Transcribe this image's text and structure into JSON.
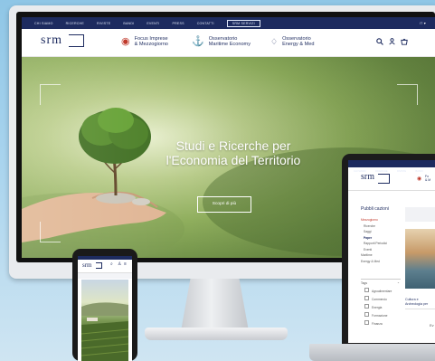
{
  "desktop": {
    "topbar": {
      "items": [
        "CHI SIAMO",
        "RICERCHE",
        "RIVISTE",
        "BANDI",
        "EVENTI",
        "PRESS",
        "CONTATTI"
      ],
      "boxed_item": "SRM SERVIZI",
      "language": "IT"
    },
    "header": {
      "logo": "srm",
      "nav": [
        {
          "line1": "Focus Imprese",
          "line2": "& Mezzogiorno",
          "icon": "flag-icon",
          "color": "#c0392b"
        },
        {
          "line1": "Osservatorio",
          "line2": "Maritime Economy",
          "icon": "anchor-icon",
          "color": "#1d2b5f"
        },
        {
          "line1": "Osservatorio",
          "line2": "Energy & Med",
          "icon": "leaf-icon",
          "color": "#1d2b5f"
        }
      ],
      "icons": [
        "search-icon",
        "user-icon",
        "cart-icon"
      ]
    },
    "hero": {
      "title_line1": "Studi e Ricerche per",
      "title_line2": "l'Economia del Territorio",
      "button": "Scopri di più"
    }
  },
  "laptop": {
    "topbar_items": [
      "CHI SIAMO",
      "RICERCHE",
      "RIVISTE",
      "BANDI"
    ],
    "logo": "srm",
    "header_text": [
      "Fo",
      "& M"
    ],
    "heading": "Pubbli cazioni",
    "sidebar_primary": "Mezzogiorno",
    "sidebar_items": [
      "Ricerche",
      "Saggi",
      "Paper",
      "Rapporti Periodici",
      "Eventi"
    ],
    "sidebar_more": [
      "Maritime",
      "Energy & Med"
    ],
    "filter_label": "Tags",
    "tags": [
      "Agroalimentare",
      "Commercio",
      "Energia",
      "Formazione",
      "Finanza"
    ],
    "card_title": "Cultura e Archeologia per",
    "card_footer": "Ev"
  },
  "colors": {
    "brand_navy": "#1d2b5f",
    "accent_red": "#c0392b"
  }
}
